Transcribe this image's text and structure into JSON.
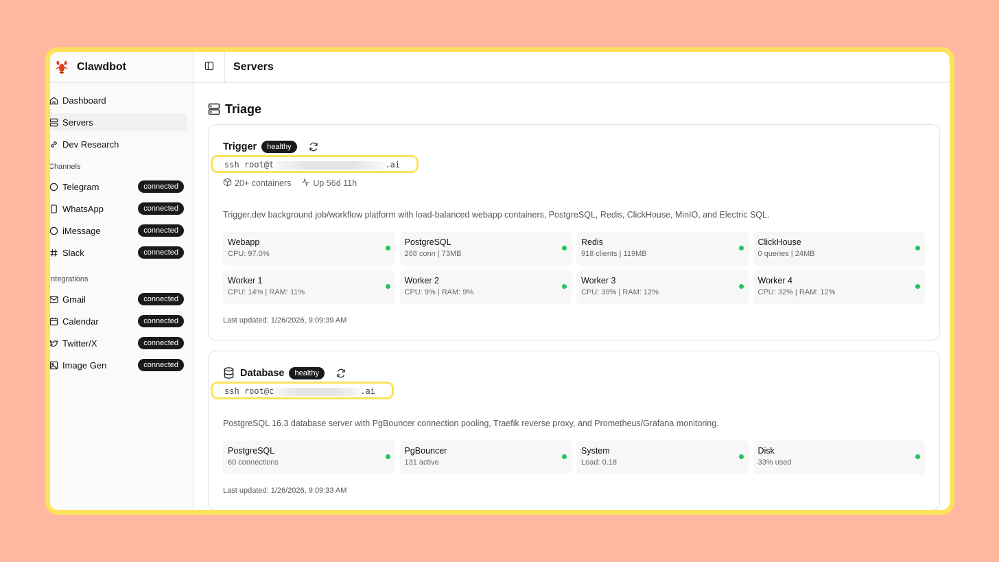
{
  "app": {
    "name": "Clawdbot"
  },
  "topbar": {
    "title": "Servers"
  },
  "sidebar": {
    "nav": [
      {
        "label": "Dashboard",
        "icon": "home-icon"
      },
      {
        "label": "Servers",
        "icon": "server-icon",
        "active": true
      },
      {
        "label": "Dev Research",
        "icon": "link-icon"
      }
    ],
    "channels_label": "Channels",
    "channels": [
      {
        "label": "Telegram",
        "icon": "chat-circle-icon",
        "status": "connected"
      },
      {
        "label": "WhatsApp",
        "icon": "phone-icon",
        "status": "connected"
      },
      {
        "label": "iMessage",
        "icon": "chat-circle-icon",
        "status": "connected"
      },
      {
        "label": "Slack",
        "icon": "hash-icon",
        "status": "connected"
      }
    ],
    "integrations_label": "Integrations",
    "integrations": [
      {
        "label": "Gmail",
        "icon": "mail-icon",
        "status": "connected"
      },
      {
        "label": "Calendar",
        "icon": "calendar-icon",
        "status": "connected"
      },
      {
        "label": "Twitter/X",
        "icon": "twitter-icon",
        "status": "connected"
      },
      {
        "label": "Image Gen",
        "icon": "image-icon",
        "status": "connected"
      }
    ]
  },
  "section": {
    "title": "Triage"
  },
  "servers": [
    {
      "name": "Trigger",
      "status": "healthy",
      "ssh_prefix": "ssh root@t",
      "ssh_suffix": ".ai",
      "containers": "20+ containers",
      "uptime": "Up 56d 11h",
      "description": "Trigger.dev background job/workflow platform with load-balanced webapp containers, PostgreSQL, Redis, ClickHouse, MinIO, and Electric SQL.",
      "services": [
        {
          "name": "Webapp",
          "detail": "CPU: 97.0%"
        },
        {
          "name": "PostgreSQL",
          "detail": "268 conn | 73MB"
        },
        {
          "name": "Redis",
          "detail": "918 clients | 119MB"
        },
        {
          "name": "ClickHouse",
          "detail": "0 queries | 24MB"
        },
        {
          "name": "Worker 1",
          "detail": "CPU: 14% | RAM: 11%"
        },
        {
          "name": "Worker 2",
          "detail": "CPU: 9% | RAM: 9%"
        },
        {
          "name": "Worker 3",
          "detail": "CPU: 39% | RAM: 12%"
        },
        {
          "name": "Worker 4",
          "detail": "CPU: 32% | RAM: 12%"
        }
      ],
      "updated": "Last updated: 1/26/2026, 9:09:39 AM"
    },
    {
      "name": "Database",
      "status": "healthy",
      "ssh_prefix": "ssh root@c",
      "ssh_suffix": ".ai",
      "description": "PostgreSQL 16.3 database server with PgBouncer connection pooling, Traefik reverse proxy, and Prometheus/Grafana monitoring.",
      "services": [
        {
          "name": "PostgreSQL",
          "detail": "60 connections"
        },
        {
          "name": "PgBouncer",
          "detail": "131 active"
        },
        {
          "name": "System",
          "detail": "Load: 0.18"
        },
        {
          "name": "Disk",
          "detail": "33% used"
        }
      ],
      "updated": "Last updated: 1/26/2026, 9:09:33 AM"
    }
  ],
  "colors": {
    "background": "#ffb8a0",
    "highlight": "#fde25c",
    "status_ok": "#22c55e",
    "badge": "#1a1a1a"
  }
}
